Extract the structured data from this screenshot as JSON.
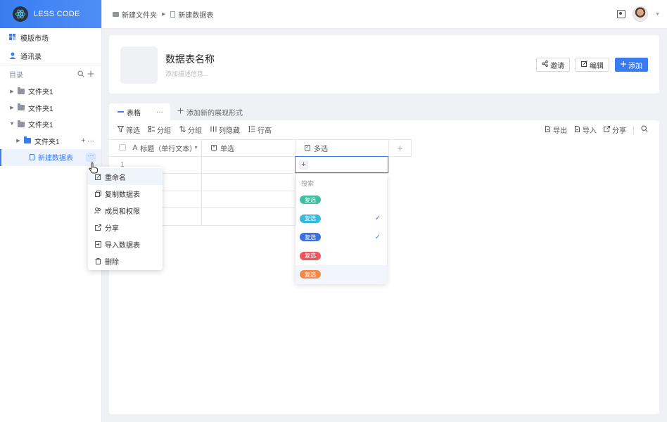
{
  "brand": {
    "name": "LESS CODE"
  },
  "sidebar": {
    "nav": [
      {
        "label": "模版市场",
        "icon": "template-icon"
      },
      {
        "label": "通讯录",
        "icon": "user-icon"
      }
    ],
    "directory_label": "目录",
    "tree": [
      {
        "label": "文件夹1"
      },
      {
        "label": "文件夹1"
      },
      {
        "label": "文件夹1"
      },
      {
        "label": "文件夹1"
      },
      {
        "label": "新建数据表"
      }
    ]
  },
  "context_menu": {
    "items": [
      {
        "label": "重命名",
        "icon": "edit-icon"
      },
      {
        "label": "复制数据表",
        "icon": "copy-icon"
      },
      {
        "label": "成员和权限",
        "icon": "members-icon"
      },
      {
        "label": "分享",
        "icon": "share-icon"
      },
      {
        "label": "导入数据表",
        "icon": "import-icon"
      },
      {
        "label": "删除",
        "icon": "trash-icon"
      }
    ]
  },
  "breadcrumb": {
    "folder": "新建文件夹",
    "sheet": "新建数据表"
  },
  "header": {
    "title": "数据表名称",
    "description_placeholder": "添加描述信息...",
    "invite_label": "邀请",
    "edit_label": "编辑",
    "add_label": "添加"
  },
  "views": {
    "active_tab": "表格",
    "add_view_label": "添加新的展现形式"
  },
  "toolbar": {
    "filter": "筛选",
    "group": "分组",
    "sort": "分组",
    "hide_columns": "列隐藏",
    "row_height": "行高",
    "export": "导出",
    "import": "导入",
    "share": "分享"
  },
  "table": {
    "columns": [
      "标题（单行文本）",
      "单选",
      "多选"
    ],
    "first_row_number": "1"
  },
  "dropdown": {
    "search_placeholder": "搜索",
    "options": [
      {
        "label": "复选",
        "color": "#3fbf9f",
        "checked": false
      },
      {
        "label": "复选",
        "color": "#39b8d9",
        "checked": true
      },
      {
        "label": "复选",
        "color": "#3a6fe8",
        "checked": true
      },
      {
        "label": "复选",
        "color": "#f0555e",
        "checked": false
      },
      {
        "label": "复选",
        "color": "#f08a4b",
        "checked": false
      }
    ],
    "check_glyph": "✓"
  }
}
